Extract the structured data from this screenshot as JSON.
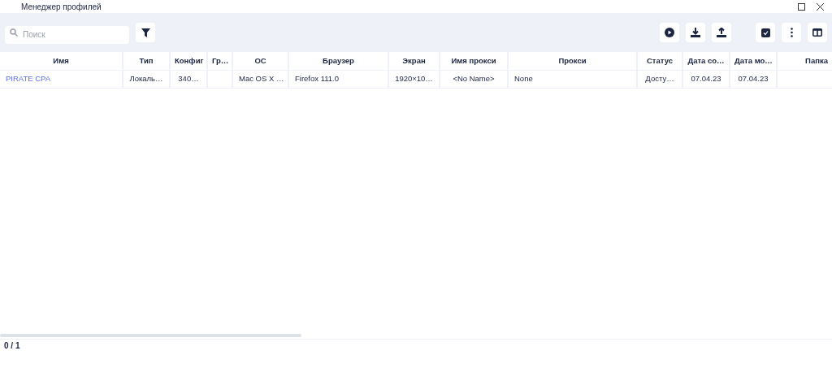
{
  "window": {
    "title": "Менеджер профилей"
  },
  "search": {
    "placeholder": "Поиск"
  },
  "table": {
    "columns": [
      {
        "label": "Имя"
      },
      {
        "label": "Тип"
      },
      {
        "label": "Конфиг"
      },
      {
        "label": "Гр…"
      },
      {
        "label": "ОС"
      },
      {
        "label": "Браузер"
      },
      {
        "label": "Экран"
      },
      {
        "label": "Имя прокси"
      },
      {
        "label": "Прокси"
      },
      {
        "label": "Статус"
      },
      {
        "label": "Дата со…"
      },
      {
        "label": "Дата мо…"
      },
      {
        "label": "Папка"
      }
    ],
    "rows": [
      {
        "cells": [
          "PIRATE CPA",
          "Локаль…",
          "340…",
          "",
          "Mac OS X …",
          "Firefox 111.0",
          "1920×10…",
          "<No Name>",
          "None",
          "Досту…",
          "07.04.23",
          "07.04.23",
          ""
        ]
      }
    ]
  },
  "status_bar": {
    "count": "0 / 1"
  }
}
